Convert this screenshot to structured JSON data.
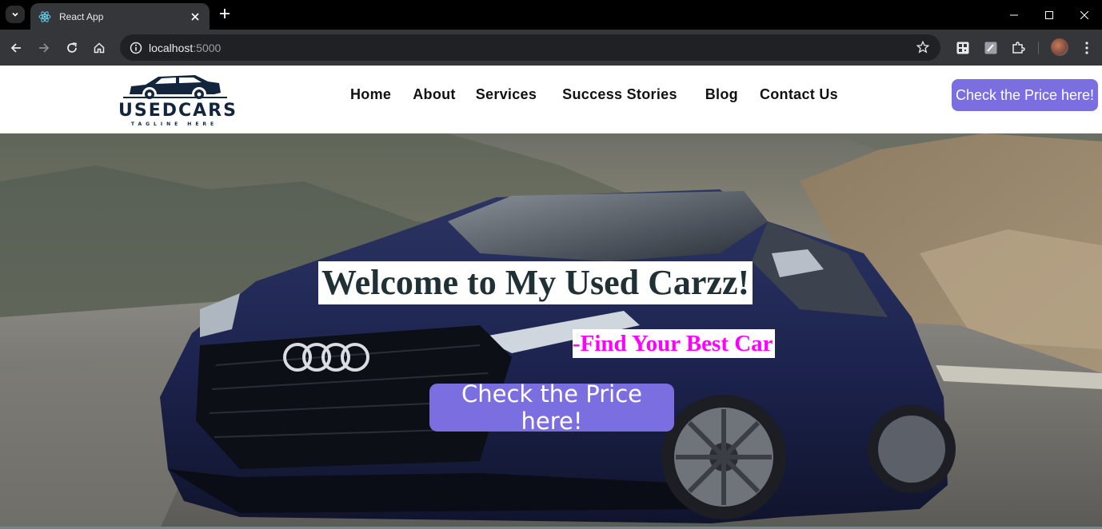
{
  "browser": {
    "tab_title": "React App",
    "url_host": "localhost",
    "url_port": ":5000",
    "icons": [
      "tab-search-icon",
      "react-icon",
      "close-icon",
      "plus-icon",
      "minimize-icon",
      "maximize-icon",
      "close-window-icon",
      "back-icon",
      "forward-icon",
      "reload-icon",
      "home-icon",
      "info-icon",
      "star-icon",
      "extension-qr-icon",
      "extension-edit-icon",
      "puzzle-icon",
      "avatar",
      "menu-dots-icon"
    ]
  },
  "navbar": {
    "logo_text": "USEDCARS",
    "logo_tagline": "TAGLINE HERE",
    "links": [
      "Home",
      "About",
      "Services",
      "Success Stories",
      "Blog",
      "Contact Us"
    ],
    "cta_label": "Check the Price here!"
  },
  "hero": {
    "title": "Welcome to My Used Carzz!",
    "subtitle": "-Find Your Best Car",
    "cta_label": "Check the Price here!"
  },
  "colors": {
    "accent": "#7b6ee0",
    "subtitle": "#ff00ff",
    "title": "#1f3135",
    "logo": "#12253d"
  }
}
